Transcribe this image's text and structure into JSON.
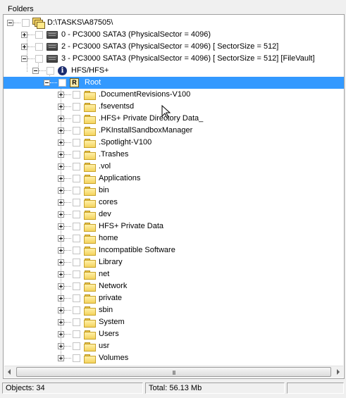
{
  "panel": {
    "title": "Folders"
  },
  "tree": {
    "root_path": "D:\\TASKS\\A87505\\",
    "disks": [
      {
        "label": "0 - PC3000 SATA3 (PhysicalSector = 4096)",
        "icon": "disk-icon",
        "expanded": false
      },
      {
        "label": "2 - PC3000 SATA3 (PhysicalSector = 4096) [ SectorSize =  512]",
        "icon": "disk-icon",
        "expanded": false
      },
      {
        "label": "3 - PC3000 SATA3 (PhysicalSector = 4096) [ SectorSize =  512] [FileVault]",
        "icon": "disk-icon",
        "expanded": true
      }
    ],
    "filesystem": {
      "label": "HFS/HFS+",
      "icon": "info-icon"
    },
    "root": {
      "label": "Root",
      "icon": "root-r-icon",
      "badge": "R",
      "selected": true
    },
    "folders": [
      ".DocumentRevisions-V100",
      ".fseventsd",
      ".HFS+ Private Directory Data_",
      ".PKInstallSandboxManager",
      ".Spotlight-V100",
      ".Trashes",
      ".vol",
      "Applications",
      "bin",
      "cores",
      "dev",
      "HFS+ Private Data",
      "home",
      "Incompatible Software",
      "Library",
      "net",
      "Network",
      "private",
      "sbin",
      "System",
      "Users",
      "usr",
      "Volumes"
    ]
  },
  "scrollbar": {
    "grip": "III"
  },
  "status": {
    "objects": "Objects: 34",
    "total": "Total: 56.13 Mb"
  },
  "colors": {
    "selection": "#3399ff",
    "folder": "#f4d35e"
  }
}
